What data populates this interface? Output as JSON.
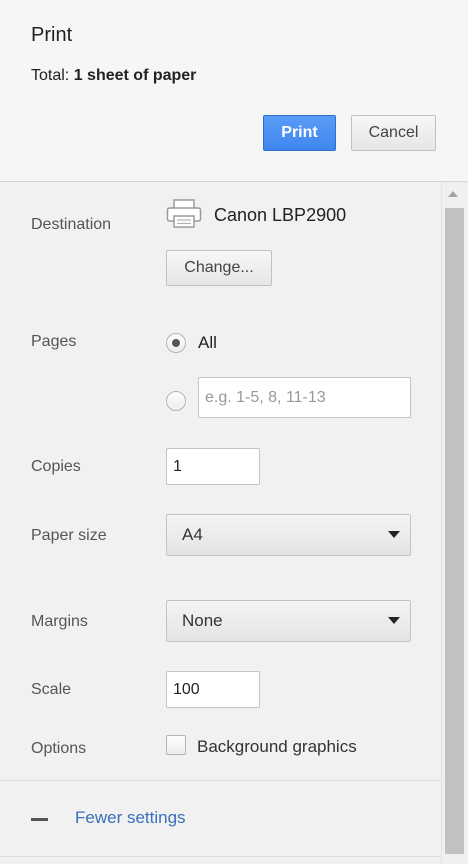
{
  "header": {
    "title": "Print",
    "total_label": "Total:",
    "total_value": "1 sheet of paper",
    "print_button": "Print",
    "cancel_button": "Cancel"
  },
  "settings": {
    "destination": {
      "label": "Destination",
      "printer_name": "Canon LBP2900",
      "printer_icon": "printer-icon",
      "change_button": "Change..."
    },
    "pages": {
      "label": "Pages",
      "option_all": "All",
      "selected": "All",
      "custom_placeholder": "e.g. 1-5, 8, 11-13"
    },
    "copies": {
      "label": "Copies",
      "value": "1"
    },
    "paper_size": {
      "label": "Paper size",
      "value": "A4"
    },
    "margins": {
      "label": "Margins",
      "value": "None"
    },
    "scale": {
      "label": "Scale",
      "value": "100"
    },
    "options": {
      "label": "Options",
      "background_graphics": "Background graphics",
      "background_graphics_checked": false
    },
    "fewer_settings": "Fewer settings"
  },
  "colors": {
    "primary_button": "#4a8ff2",
    "link": "#3a6fb8"
  }
}
